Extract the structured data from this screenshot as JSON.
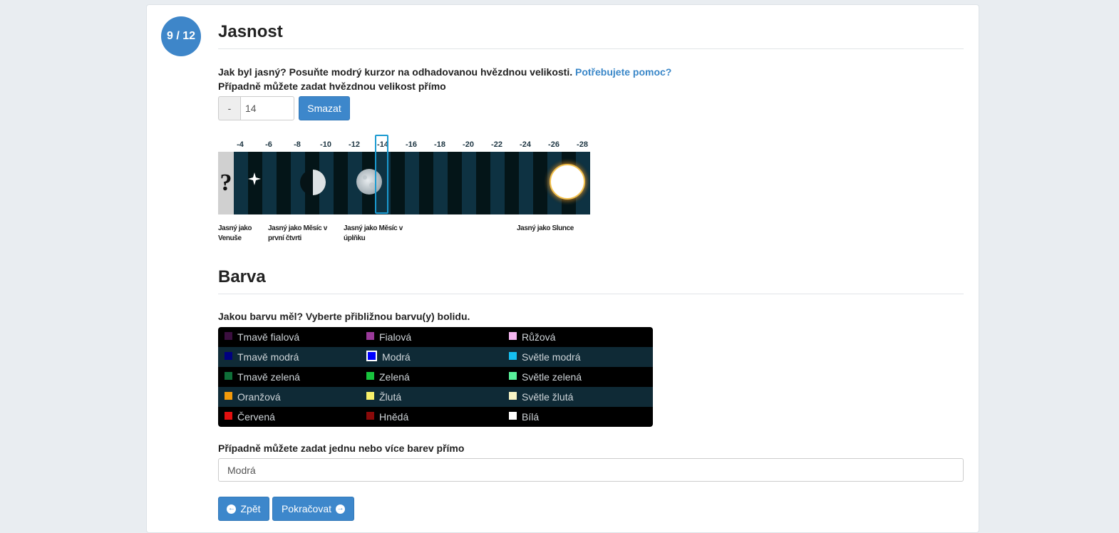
{
  "progress": {
    "step_label": "9 / 12",
    "current": 9,
    "total": 12
  },
  "brightness": {
    "title": "Jasnost",
    "question": "Jak byl jasný? Posuňte modrý kurzor na odhadovanou hvězdnou velikosti.",
    "help_link": "Potřebujete pomoc?",
    "direct_prompt": "Případně můžete zadat hvězdnou velikost přímo",
    "input_prefix": "-",
    "input_value": "14",
    "clear_button": "Smazat",
    "ticks": [
      "-4",
      "-6",
      "-8",
      "-10",
      "-12",
      "-14",
      "-16",
      "-18",
      "-20",
      "-22",
      "-24",
      "-26",
      "-28"
    ],
    "selected_tick": "-14",
    "unknown_label": "?",
    "captions": {
      "venus": [
        "Jasný jako",
        "Venuše"
      ],
      "first_quarter": [
        "Jasný jako Měsíc v",
        "první čtvrti"
      ],
      "full_moon": [
        "Jasný jako Měsíc v",
        "úplňku"
      ],
      "sun": [
        "Jasný jako Slunce"
      ]
    }
  },
  "color": {
    "title": "Barva",
    "question": "Jakou barvu měl? Vyberte přibližnou barvu(y) bolidu.",
    "rows": [
      [
        {
          "label": "Tmavě fialová",
          "color": "#3b0f3f"
        },
        {
          "label": "Fialová",
          "color": "#9a3a9a"
        },
        {
          "label": "Růžová",
          "color": "#f4b6f0"
        }
      ],
      [
        {
          "label": "Tmavě modrá",
          "color": "#000080"
        },
        {
          "label": "Modrá",
          "color": "#0000ff",
          "selected": true
        },
        {
          "label": "Světle modrá",
          "color": "#15c0f2"
        }
      ],
      [
        {
          "label": "Tmavě zelená",
          "color": "#0f6e38"
        },
        {
          "label": "Zelená",
          "color": "#18c33d"
        },
        {
          "label": "Světle zelená",
          "color": "#59f09a"
        }
      ],
      [
        {
          "label": "Oranžová",
          "color": "#f39a0b"
        },
        {
          "label": "Žlutá",
          "color": "#f8f06a"
        },
        {
          "label": "Světle žlutá",
          "color": "#f7f3c5"
        }
      ],
      [
        {
          "label": "Červená",
          "color": "#e10f0f"
        },
        {
          "label": "Hnědá",
          "color": "#8a0a0a"
        },
        {
          "label": "Bílá",
          "color": "#ffffff"
        }
      ]
    ],
    "direct_prompt": "Případně můžete zadat jednu nebo více barev přímo",
    "input_value": "Modrá"
  },
  "nav": {
    "back_label": "Zpět",
    "next_label": "Pokračovat"
  },
  "theme": {
    "accent": "#3d87cb",
    "panel_bg": "#ffffff",
    "page_bg": "#e9edf1"
  }
}
